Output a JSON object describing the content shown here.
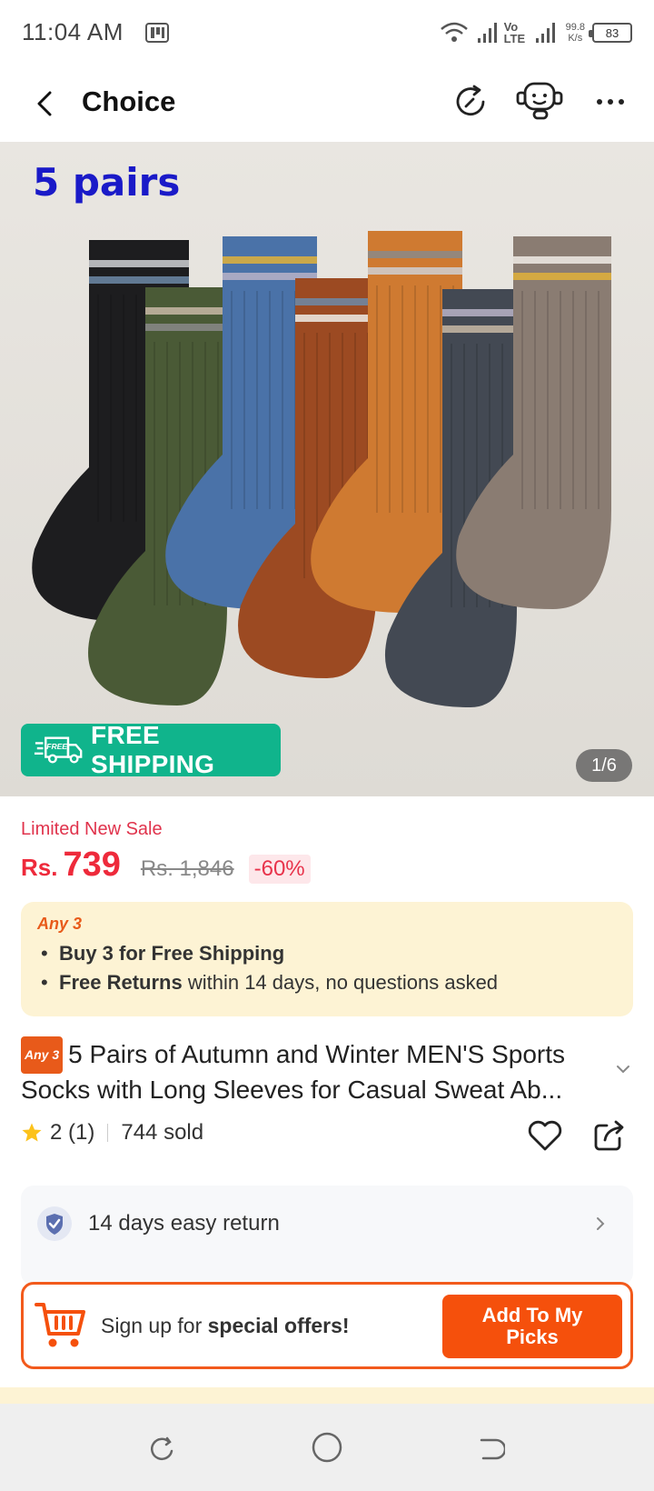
{
  "status_bar": {
    "time": "11:04 AM",
    "network_label": "Vo LTE",
    "speed_value": "99.8",
    "speed_unit": "K/s",
    "battery": "83"
  },
  "header": {
    "title": "Choice"
  },
  "product_image": {
    "overlay_text": "5 pairs",
    "badge_icon_text": "FREE",
    "badge_text": "FREE SHIPPING",
    "counter": "1/6",
    "sock_colors": [
      "#1d1d1f",
      "#4a5a36",
      "#4a72a8",
      "#9c4a22",
      "#cf7a31",
      "#434953",
      "#8a7c72"
    ]
  },
  "price": {
    "sale_label": "Limited New Sale",
    "currency": "Rs.",
    "value": "739",
    "original": "Rs. 1,846",
    "discount": "-60%"
  },
  "promo": {
    "title": "Any 3",
    "line1_bold": "Buy 3 for  Free Shipping",
    "line2_bold": "Free Returns",
    "line2_rest": " within 14 days, no questions asked"
  },
  "product": {
    "tag": "Any 3",
    "title": "5 Pairs of Autumn and Winter MEN'S Sports Socks with Long Sleeves for Casual Sweat Ab...",
    "rating": "2 (1)",
    "sold": "744 sold"
  },
  "service": {
    "return_text": "14 days easy return"
  },
  "signup": {
    "text_prefix": "Sign up for ",
    "text_bold": "special offers!",
    "button_line1": "Add To My",
    "button_line2": "Picks"
  },
  "colors": {
    "accent": "#f5500c",
    "price_red": "#ee2a3b",
    "free_shipping_green": "#10b48c",
    "promo_bg": "#fdf3d4"
  }
}
